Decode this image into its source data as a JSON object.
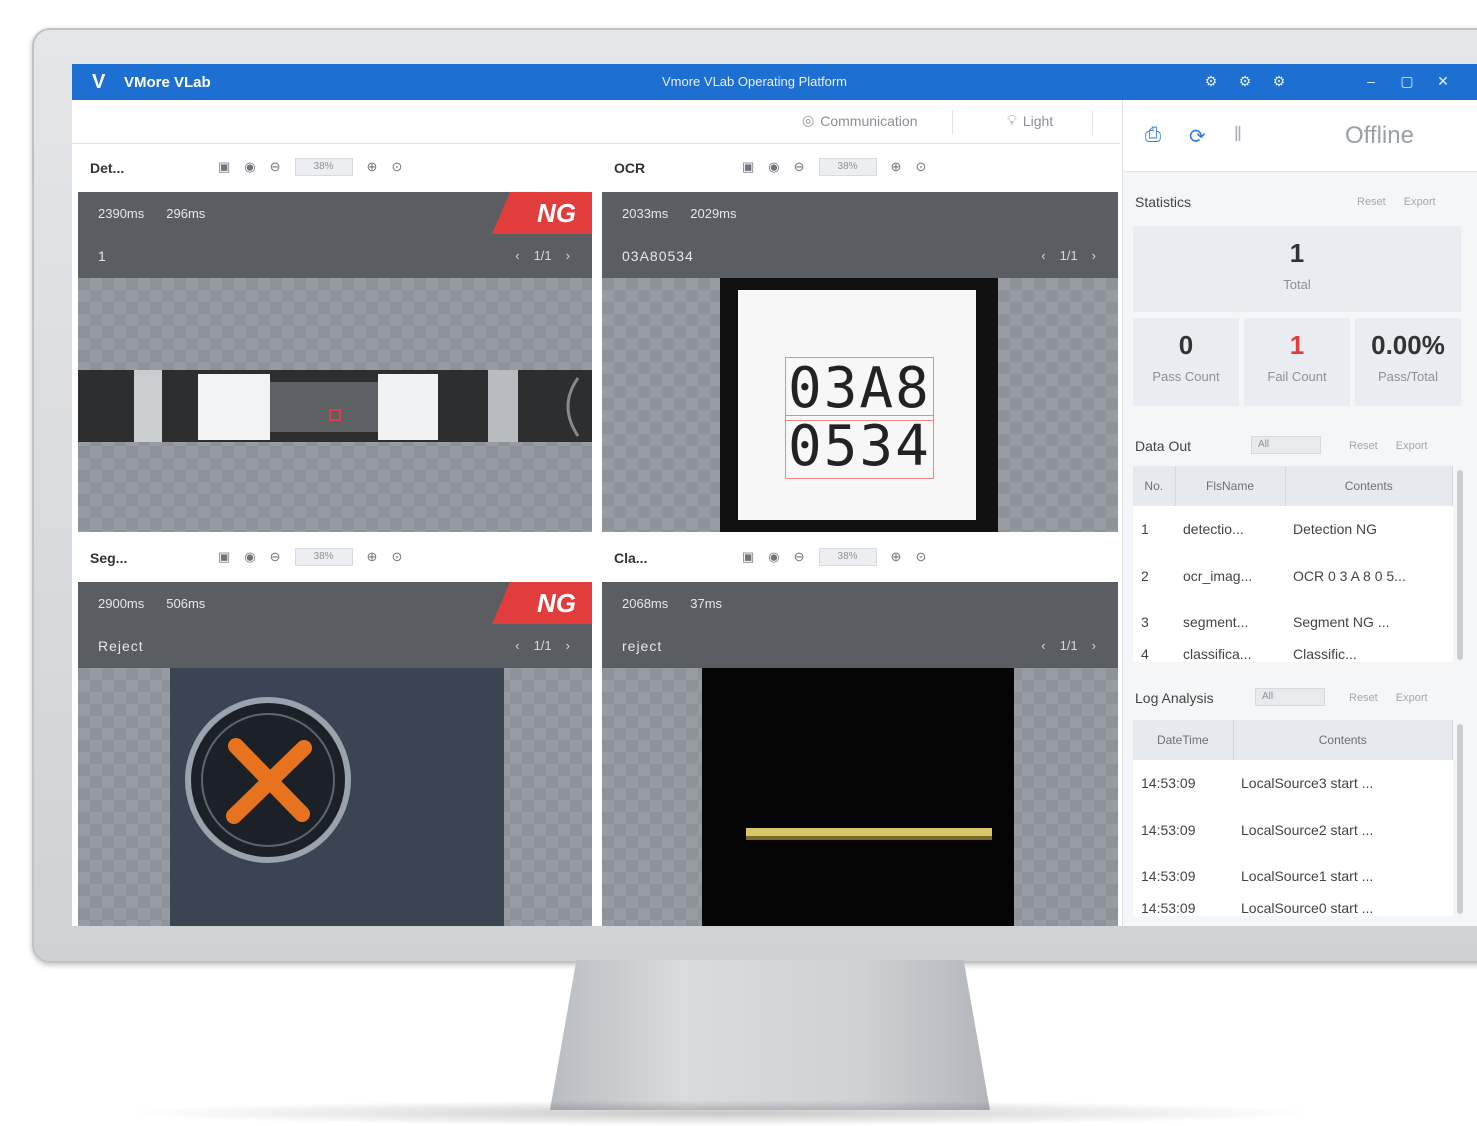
{
  "titlebar": {
    "app_name": "VMore VLab",
    "title": "Vmore VLab Operating Platform",
    "icons": [
      "gear-icon",
      "gear-icon",
      "settings-icon"
    ],
    "controls": [
      "minimize-icon",
      "maximize-icon",
      "close-icon"
    ]
  },
  "toolbar": {
    "communication_label": "Communication",
    "light_label": "Light"
  },
  "panels": [
    {
      "name": "Det...",
      "zoom": "38%",
      "time1": "2390ms",
      "time2": "296ms",
      "result": "1",
      "page": "1/1",
      "status": "NG"
    },
    {
      "name": "OCR",
      "zoom": "38%",
      "time1": "2033ms",
      "time2": "2029ms",
      "result": "03A80534",
      "page": "1/1",
      "status": ""
    },
    {
      "name": "Seg...",
      "zoom": "38%",
      "time1": "2900ms",
      "time2": "506ms",
      "result": "Reject",
      "page": "1/1",
      "status": "NG"
    },
    {
      "name": "Cla...",
      "zoom": "38%",
      "time1": "2068ms",
      "time2": "37ms",
      "result": "reject",
      "page": "1/1",
      "status": ""
    }
  ],
  "ocr_text": {
    "line1": "03A8",
    "line2": "0534"
  },
  "sidebar": {
    "status": "Offline",
    "statistics": {
      "title": "Statistics",
      "reset": "Reset",
      "export": "Export",
      "total_value": "1",
      "total_label": "Total",
      "pass_value": "0",
      "pass_label": "Pass Count",
      "fail_value": "1",
      "fail_label": "Fail Count",
      "rate_value": "0.00%",
      "rate_label": "Pass/Total"
    },
    "data_out": {
      "title": "Data Out",
      "filter": "All",
      "reset": "Reset",
      "export": "Export",
      "headers": [
        "No.",
        "FlsName",
        "Contents"
      ],
      "rows": [
        [
          "1",
          "detectio...",
          "Detection NG"
        ],
        [
          "2",
          "ocr_imag...",
          "OCR 0 3 A 8 0 5..."
        ],
        [
          "3",
          "segment...",
          "Segment NG ..."
        ],
        [
          "4",
          "classifica...",
          "Classific..."
        ]
      ]
    },
    "log": {
      "title": "Log Analysis",
      "filter": "All",
      "reset": "Reset",
      "export": "Export",
      "headers": [
        "DateTime",
        "Contents"
      ],
      "rows": [
        [
          "14:53:09",
          "LocalSource3 start ..."
        ],
        [
          "14:53:09",
          "LocalSource2 start ..."
        ],
        [
          "14:53:09",
          "LocalSource1 start ..."
        ],
        [
          "14:53:09",
          "LocalSource0 start ..."
        ]
      ]
    }
  },
  "colors": {
    "accent": "#1d6fd1",
    "ng": "#e23d3d",
    "fail": "#e23d3d"
  }
}
